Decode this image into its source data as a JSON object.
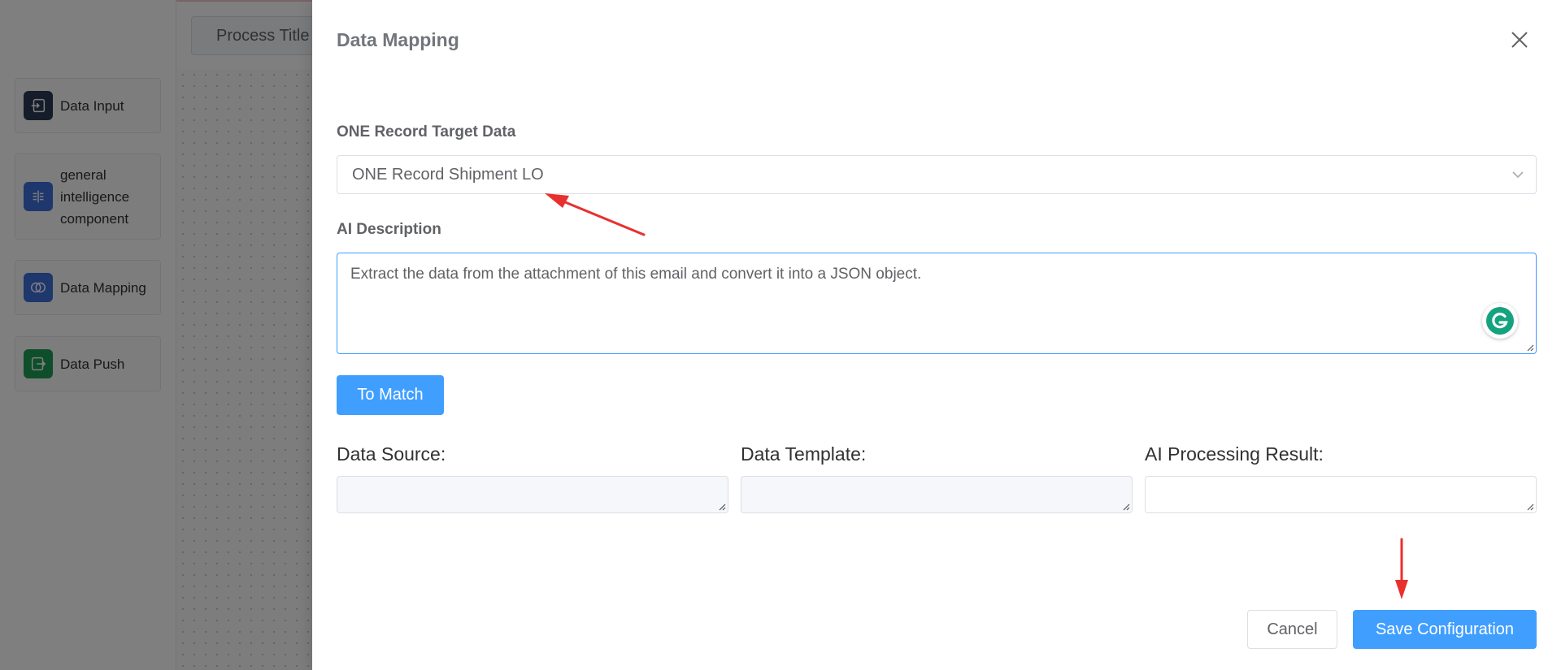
{
  "background": {
    "toolbar_input_value": "Process Title",
    "components": [
      {
        "label": "Data Input",
        "icon": "data-input-icon",
        "color": "#2b3a55"
      },
      {
        "label": "general intelligence component",
        "icon": "intelligence-icon",
        "color": "#3d6fd8"
      },
      {
        "label": "Data Mapping",
        "icon": "data-mapping-icon",
        "color": "#3d6fd8"
      },
      {
        "label": "Data Push",
        "icon": "data-push-icon",
        "color": "#1f9d55"
      }
    ]
  },
  "drawer": {
    "title": "Data Mapping",
    "target_label": "ONE Record Target Data",
    "target_value": "ONE Record Shipment LO",
    "ai_label": "AI Description",
    "ai_value": "Extract the data from the attachment of this email and convert it into a JSON object.",
    "match_button": "To Match",
    "columns": [
      {
        "label": "Data Source:",
        "state": "disabled"
      },
      {
        "label": "Data Template:",
        "state": "disabled"
      },
      {
        "label": "AI Processing Result:",
        "state": "enabled"
      }
    ],
    "cancel_button": "Cancel",
    "save_button": "Save Configuration"
  },
  "colors": {
    "primary": "#409eff",
    "annotation_arrow": "#e8302f",
    "grammarly": "#15a37f"
  }
}
